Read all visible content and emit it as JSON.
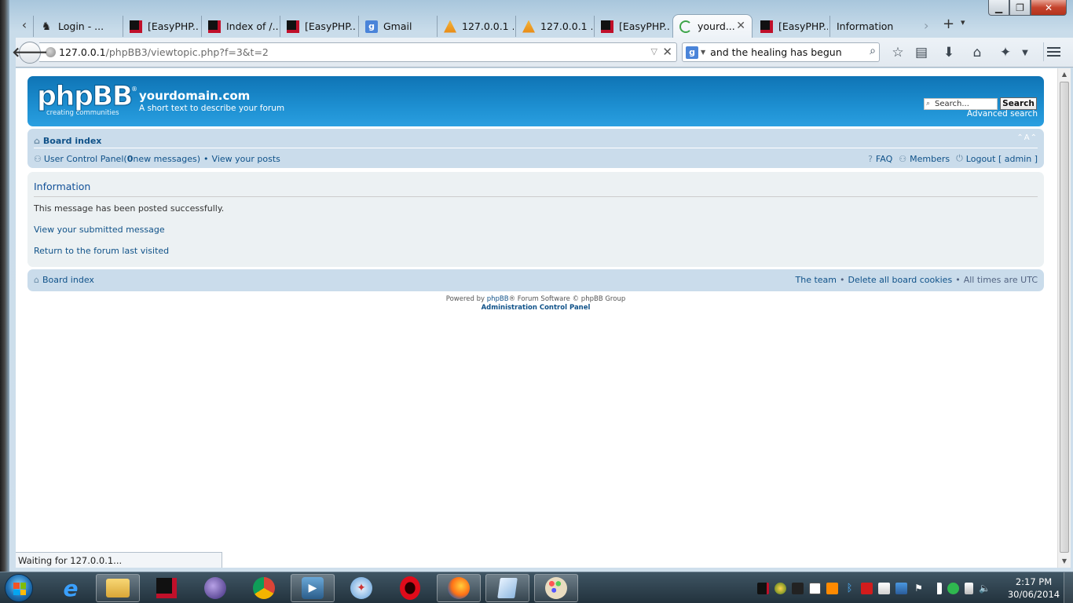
{
  "browser": {
    "tabs": [
      {
        "title": "Login - ...",
        "icon": "login-icon"
      },
      {
        "title": "[EasyPHP...",
        "icon": "easyphp-icon"
      },
      {
        "title": "Index of /...",
        "icon": "easyphp-icon"
      },
      {
        "title": "[EasyPHP...",
        "icon": "easyphp-icon"
      },
      {
        "title": "Gmail",
        "icon": "google-icon"
      },
      {
        "title": "127.0.0.1 ...",
        "icon": "phpmyadmin-icon"
      },
      {
        "title": "127.0.0.1 ...",
        "icon": "phpmyadmin-icon"
      },
      {
        "title": "[EasyPHP...",
        "icon": "easyphp-icon"
      },
      {
        "title": "yourd...",
        "icon": "loading-icon"
      },
      {
        "title": "[EasyPHP...",
        "icon": "easyphp-icon"
      },
      {
        "title": "Information",
        "icon": ""
      }
    ],
    "url_host": "127.0.0.1",
    "url_path": "/phpBB3/viewtopic.php?f=3&t=2",
    "search_text": "and the healing has begun",
    "status_text": "Waiting for 127.0.0.1..."
  },
  "forum": {
    "logo_text": "phpBB",
    "logo_sub": "creating communities",
    "logo_reg": "®",
    "site_name": "yourdomain.com",
    "site_desc": "A short text to describe your forum",
    "search_placeholder": "Search...",
    "search_button": "Search",
    "advanced_search": "Advanced search",
    "board_index": "Board index",
    "font_size_toggle": "⌃A⌃",
    "ucp": "User Control Panel",
    "ucp_open": " (",
    "new_messages_count": "0",
    "new_messages_label": " new messages)",
    "bullet": "•",
    "view_posts": "View your posts",
    "faq": "FAQ",
    "members": "Members",
    "logout": "Logout [ admin ]"
  },
  "info": {
    "heading": "Information",
    "message": "This message has been posted successfully.",
    "link_view": "View your submitted message",
    "link_return": "Return to the forum last visited"
  },
  "footer": {
    "board_index": "Board index",
    "team": "The team",
    "delete_cookies": "Delete all board cookies",
    "times": "All times are UTC",
    "powered_prefix": "Powered by ",
    "powered_link": "phpBB",
    "powered_suffix": "® Forum Software © phpBB Group",
    "acp": "Administration Control Panel"
  },
  "taskbar": {
    "time": "2:17 PM",
    "date": "30/06/2014"
  }
}
